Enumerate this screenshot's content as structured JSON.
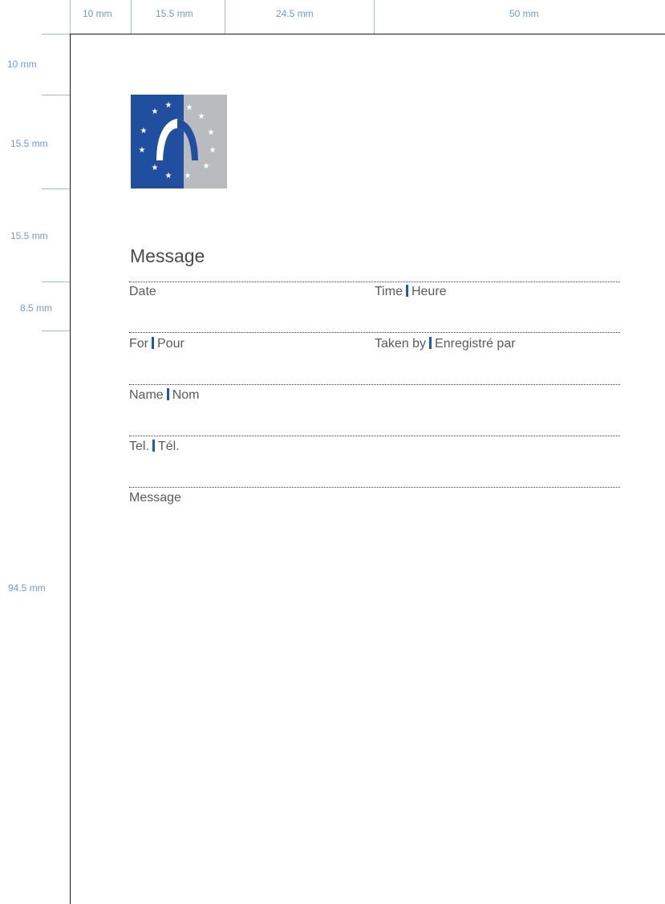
{
  "dimensions": {
    "top": [
      "10 mm",
      "15.5 mm",
      "24.5 mm",
      "50 mm"
    ],
    "left": [
      "10 mm",
      "15.5 mm",
      "15.5 mm",
      "8.5 mm",
      "94.5 mm"
    ]
  },
  "colors": {
    "dimension_text": "#6f9bd1",
    "logo_blue": "#1f4f9e",
    "logo_grey": "#b9bbbf",
    "separator_blue": "#1f5aa8"
  },
  "form": {
    "title": "Message",
    "fields": {
      "date": "Date",
      "time": "Time",
      "heure": "Heure",
      "for": "For",
      "pour": "Pour",
      "taken_by": "Taken by",
      "enregistre_par": "Enregistré par",
      "name": "Name",
      "nom": "Nom",
      "tel": "Tel.",
      "tel_fr": "Tél.",
      "message": "Message"
    }
  }
}
